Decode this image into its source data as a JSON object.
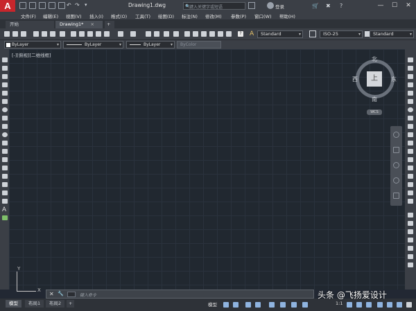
{
  "app": {
    "logo_letter": "A",
    "title": "Drawing1.dwg"
  },
  "search": {
    "placeholder": "键入关键字或短语"
  },
  "account": {
    "login_label": "登录"
  },
  "window_controls": {
    "minimize": "—",
    "maximize": "☐",
    "close": "✕"
  },
  "menu": {
    "items": [
      "文件(F)",
      "编辑(E)",
      "视图(V)",
      "插入(I)",
      "格式(O)",
      "工具(T)",
      "绘图(D)",
      "标注(N)",
      "修改(M)",
      "参数(P)",
      "窗口(W)",
      "帮助(H)"
    ]
  },
  "tabs": {
    "items": [
      {
        "label": "开始",
        "active": false
      },
      {
        "label": "Drawing1*",
        "active": true
      }
    ],
    "add_label": "+"
  },
  "styles": {
    "text_style": "Standard",
    "dim_style": "ISO-25",
    "table_style": "Standard"
  },
  "properties": {
    "color": "ByLayer",
    "linetype": "ByLayer",
    "lineweight": "ByLayer",
    "plotstyle": "ByColor"
  },
  "viewport": {
    "label": "[-][俯视][二维线框]"
  },
  "viewcube": {
    "face": "上",
    "north": "北",
    "south": "南",
    "east": "东",
    "west": "西",
    "wcs": "WCS"
  },
  "ucs": {
    "x_label": "X",
    "y_label": "Y"
  },
  "command": {
    "prompt": "键入命令"
  },
  "layout_tabs": [
    "模型",
    "布局1",
    "布局2"
  ],
  "layout_add": "+",
  "status": {
    "model_label": "模型",
    "scale": "1:1"
  },
  "watermark": "头条 @飞扬爱设计",
  "colors": {
    "accent": "#c8262c",
    "canvas": "#212830",
    "panel": "#3b3f46"
  }
}
